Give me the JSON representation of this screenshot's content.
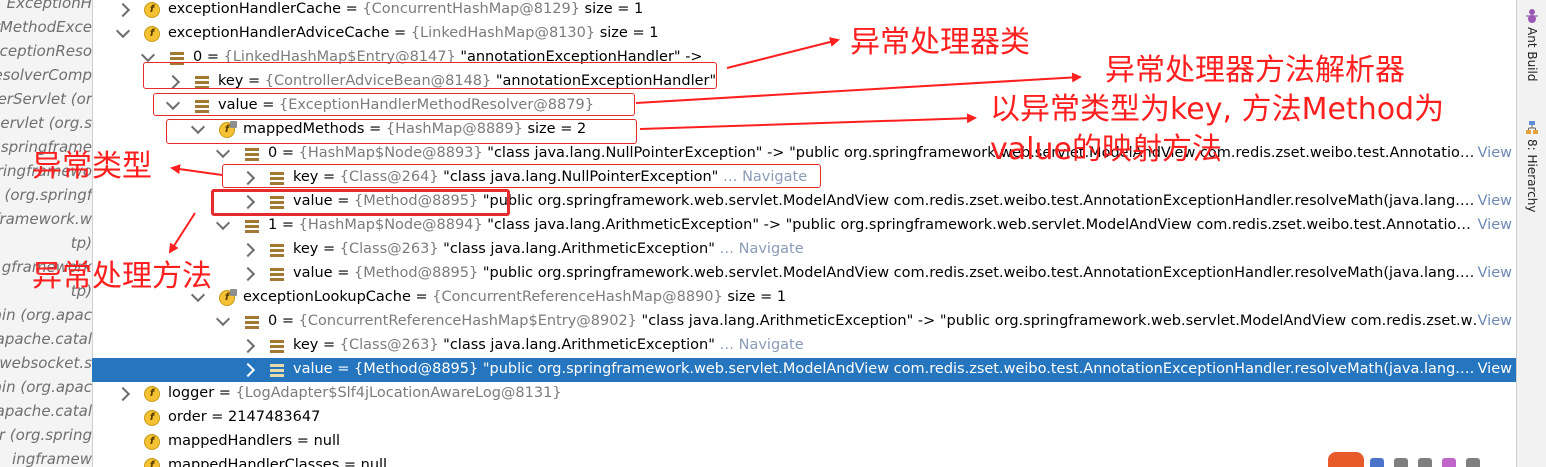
{
  "left_frames": [
    "ExceptionH",
    "erMethodExce",
    "xceptionReso",
    "esolverComp",
    "erServlet (or",
    "Servlet (org.s",
    "springframe",
    "ringframewo",
    "(org.springf",
    "framework.w",
    "tp)",
    "gframework",
    "tp)",
    "ain (org.apac",
    "apache.catal",
    "websocket.s",
    "ain (org.apac",
    "apache.catal",
    "er (org.spring",
    "ingframew"
  ],
  "tree": [
    {
      "name": "exceptionHandlerCache",
      "type": "{ConcurrentHashMap@8129}",
      "suffix": "size = 1"
    },
    {
      "name": "exceptionHandlerAdviceCache",
      "type": "{LinkedHashMap@8130}",
      "suffix": "size = 1"
    },
    {
      "name": "0",
      "type": "{LinkedHashMap$Entry@8147}",
      "suffix": "\"annotationExceptionHandler\" ->"
    },
    {
      "name": "key",
      "type": "{ControllerAdviceBean@8148}",
      "suffix": "\"annotationExceptionHandler\""
    },
    {
      "name": "value",
      "type": "{ExceptionHandlerMethodResolver@8879}",
      "suffix": ""
    },
    {
      "name": "mappedMethods",
      "type": "{HashMap@8889}",
      "suffix": "size = 2"
    },
    {
      "name": "0",
      "type": "{HashMap$Node@8893}",
      "suffix": "\"class java.lang.NullPointerException\" -> \"public org.springframework.web.servlet.ModelAndView com.redis.zset.weibo.test.Annotatio…"
    },
    {
      "name": "key",
      "type": "{Class@264}",
      "suffix": "\"class java.lang.NullPointerException\"",
      "nav": "… Navigate"
    },
    {
      "name": "value",
      "type": "{Method@8895}",
      "suffix": "\"public org.springframework.web.servlet.ModelAndView com.redis.zset.weibo.test.AnnotationExceptionHandler.resolveMath(java.lang.…"
    },
    {
      "name": "1",
      "type": "{HashMap$Node@8894}",
      "suffix": "\"class java.lang.ArithmeticException\" -> \"public org.springframework.web.servlet.ModelAndView com.redis.zset.weibo.test.Annotatio…"
    },
    {
      "name": "key",
      "type": "{Class@263}",
      "suffix": "\"class java.lang.ArithmeticException\"",
      "nav": "… Navigate"
    },
    {
      "name": "value",
      "type": "{Method@8895}",
      "suffix": "\"public org.springframework.web.servlet.ModelAndView com.redis.zset.weibo.test.AnnotationExceptionHandler.resolveMath(java.lang.…"
    },
    {
      "name": "exceptionLookupCache",
      "type": "{ConcurrentReferenceHashMap@8890}",
      "suffix": "size = 1"
    },
    {
      "name": "0",
      "type": "{ConcurrentReferenceHashMap$Entry@8902}",
      "suffix": "\"class java.lang.ArithmeticException\" -> \"public org.springframework.web.servlet.ModelAndView com.redis.zset.w…"
    },
    {
      "name": "key",
      "type": "{Class@263}",
      "suffix": "\"class java.lang.ArithmeticException\"",
      "nav": "… Navigate"
    },
    {
      "name": "value",
      "type": "{Method@8895}",
      "suffix": "\"public org.springframework.web.servlet.ModelAndView com.redis.zset.weibo.test.AnnotationExceptionHandler.resolveMath(java.lang.…"
    },
    {
      "name": "logger",
      "type": "{LogAdapter$Slf4jLocationAwareLog@8131}",
      "suffix": ""
    },
    {
      "name": "order",
      "type": "",
      "suffix": "2147483647"
    },
    {
      "name": "mappedHandlers",
      "type": "",
      "suffix": "null"
    },
    {
      "name": "mappedHandlerClasses",
      "type": "",
      "suffix": "null"
    }
  ],
  "view_label": "View",
  "tool_tabs": [
    "Ant Build",
    "8: Hierarchy"
  ],
  "annotations": {
    "exception_handler_class": "异常处理器类",
    "exception_handler_method_resolver": "异常处理器方法解析器",
    "mapping_line1": "以异常类型为key, 方法Method为",
    "mapping_line2": "value的映射方法",
    "exception_type": "异常类型",
    "exception_handler_method": "异常处理方法"
  },
  "colors": {
    "annotation_red": "#ff1f1f",
    "selection": "#2675bf",
    "field_icon": "#f4c233"
  }
}
